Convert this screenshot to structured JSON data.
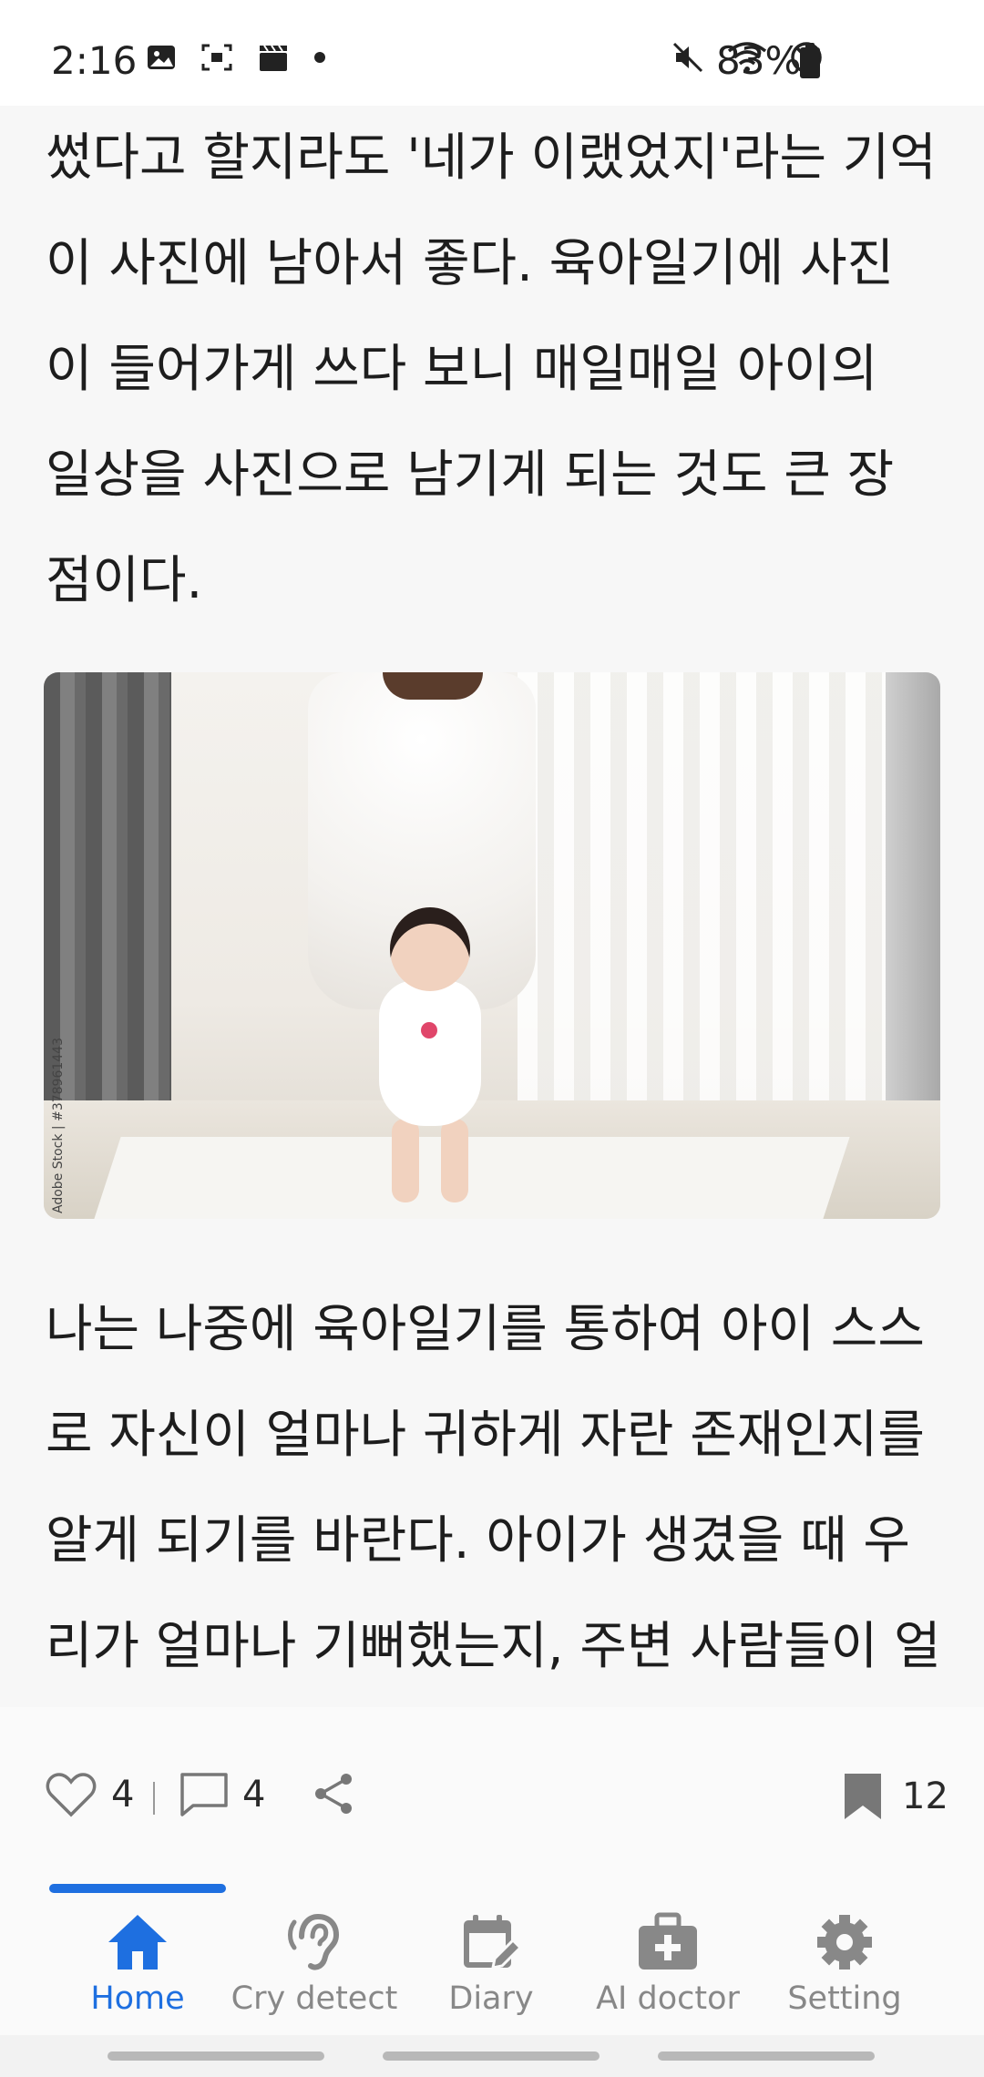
{
  "status_bar": {
    "time": "2:16",
    "battery": "83%",
    "left_icons": [
      "image-icon",
      "screenshot-icon",
      "clapper-icon",
      "dot-icon"
    ],
    "right_icons": [
      "mute-icon",
      "wifi-icon",
      "no-disturb-icon",
      "battery-icon"
    ]
  },
  "article": {
    "paragraph_1": [
      "썼다고 할지라도 '네가 이랬었지'라는 기억",
      "이 사진에 남아서 좋다. 육아일기에 사진",
      "이 들어가게 쓰다 보니 매일매일 아이의",
      "일상을 사진으로 남기게 되는 것도 큰 장",
      "점이다."
    ],
    "photo": {
      "credit": "Adobe Stock | #378961443"
    },
    "paragraph_2": [
      "나는 나중에 육아일기를 통하여 아이 스스",
      "로 자신이 얼마나 귀하게 자란 존재인지를",
      "알게 되기를 바란다. 아이가 생겼을 때 우",
      "리가 얼마나 기뻐했는지, 주변 사람들이 얼"
    ]
  },
  "actions": {
    "likes": "4",
    "comments": "4",
    "bookmarks": "12"
  },
  "nav": {
    "items": [
      {
        "label": "Home",
        "icon": "home-icon",
        "active": true
      },
      {
        "label": "Cry detect",
        "icon": "ear-icon",
        "active": false
      },
      {
        "label": "Diary",
        "icon": "calendar-edit-icon",
        "active": false
      },
      {
        "label": "AI doctor",
        "icon": "medical-bag-icon",
        "active": false
      },
      {
        "label": "Setting",
        "icon": "gear-icon",
        "active": false
      }
    ]
  },
  "colors": {
    "accent": "#1e6fe0",
    "inactive": "#888888",
    "text": "#1d1d1d"
  }
}
